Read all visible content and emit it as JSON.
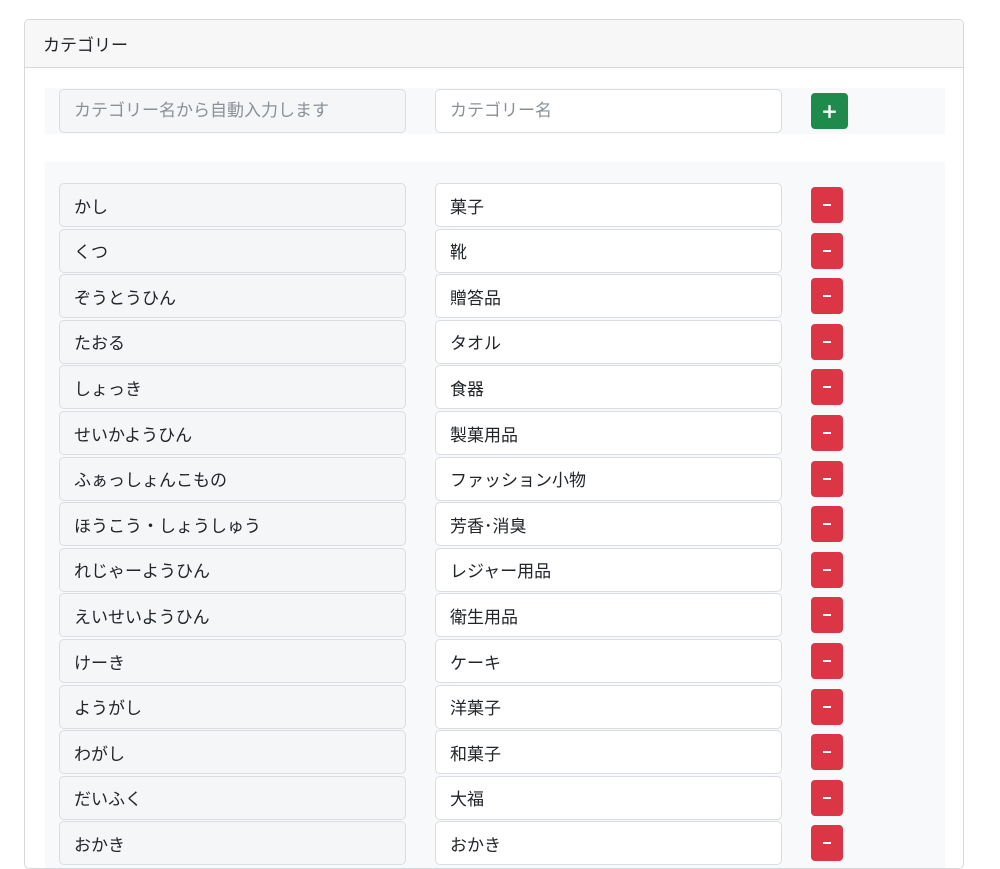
{
  "card": {
    "title": "カテゴリー"
  },
  "new_entry": {
    "yomi_placeholder": "カテゴリー名から自動入力します",
    "name_placeholder": "カテゴリー名",
    "add_label": "+"
  },
  "colors": {
    "add_button": "#1e8a4c",
    "remove_button": "#dc3545"
  },
  "icons": {
    "add": "plus-icon",
    "remove": "minus-icon"
  },
  "categories": [
    {
      "yomi": "かし",
      "name": "菓子"
    },
    {
      "yomi": "くつ",
      "name": "靴"
    },
    {
      "yomi": "ぞうとうひん",
      "name": "贈答品"
    },
    {
      "yomi": "たおる",
      "name": "タオル"
    },
    {
      "yomi": "しょっき",
      "name": "食器"
    },
    {
      "yomi": "せいかようひん",
      "name": "製菓用品"
    },
    {
      "yomi": "ふぁっしょんこもの",
      "name": "ファッション小物"
    },
    {
      "yomi": "ほうこう・しょうしゅう",
      "name": "芳香･消臭"
    },
    {
      "yomi": "れじゃーようひん",
      "name": "レジャー用品"
    },
    {
      "yomi": "えいせいようひん",
      "name": "衛生用品"
    },
    {
      "yomi": "けーき",
      "name": "ケーキ"
    },
    {
      "yomi": "ようがし",
      "name": "洋菓子"
    },
    {
      "yomi": "わがし",
      "name": "和菓子"
    },
    {
      "yomi": "だいふく",
      "name": "大福"
    },
    {
      "yomi": "おかき",
      "name": "おかき"
    }
  ]
}
